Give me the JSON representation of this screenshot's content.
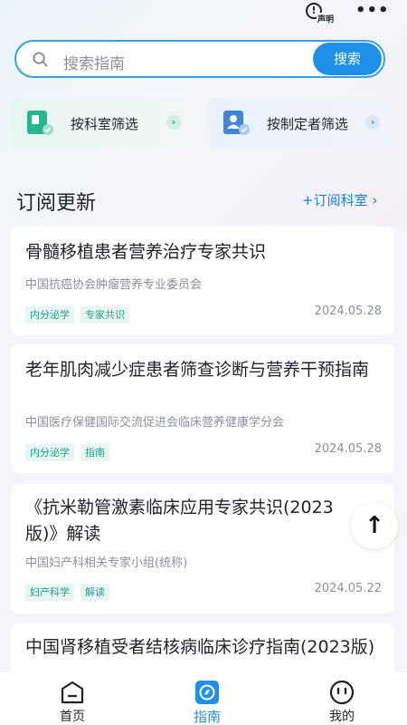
{
  "topbar": {
    "statement_label": "声明",
    "statement_glyph": "!",
    "more_glyph": "•••"
  },
  "search": {
    "placeholder": "搜索指南",
    "button_label": "搜索"
  },
  "filters": {
    "by_department": "按科室筛选",
    "by_maker": "按制定者筛选",
    "arrow": "›"
  },
  "subscription": {
    "title": "订阅更新",
    "subscribe_link": "+订阅科室 ›"
  },
  "guides": [
    {
      "title": "骨髓移植患者营养治疗专家共识",
      "org": "中国抗癌协会肿瘤营养专业委员会",
      "tags": [
        "内分泌学",
        "专家共识"
      ],
      "date": "2024.05.28"
    },
    {
      "title": "老年肌肉减少症患者筛查诊断与营养干预指南",
      "org": "中国医疗保健国际交流促进会临床营养健康学分会",
      "tags": [
        "内分泌学",
        "指南"
      ],
      "date": "2024.05.28"
    },
    {
      "title": "《抗米勒管激素临床应用专家共识(2023版)》解读",
      "org": "中国妇产科相关专家小组(统称)",
      "tags": [
        "妇产科学",
        "解读"
      ],
      "date": "2024.05.22"
    },
    {
      "title": "中国肾移植受者结核病临床诊疗指南(2023版)",
      "org": "",
      "tags": [],
      "date": ""
    }
  ],
  "scroll_top_glyph": "↑",
  "tabs": {
    "home": "首页",
    "guide": "指南",
    "me": "我的"
  },
  "colors": {
    "accent": "#1e90e8",
    "tag_bg": "#e7f6f3",
    "tag_text": "#22a07f",
    "dept_icon": "#23b98c",
    "maker_icon": "#3f86d6"
  }
}
